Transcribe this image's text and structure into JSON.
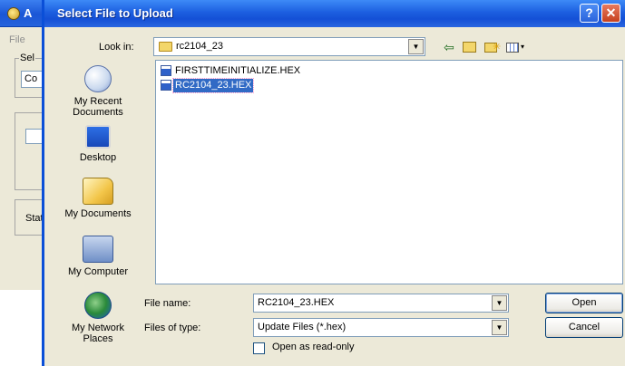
{
  "background_window": {
    "title_fragment": "A",
    "menu_file": "File",
    "group1_label": "Sel",
    "combo_value": "Co",
    "group3_label": "Stat"
  },
  "dialog": {
    "title": "Select File to Upload",
    "help_glyph": "?",
    "close_glyph": "✕",
    "look_in_label": "Look in:",
    "look_in_value": "rc2104_23",
    "toolbar": {
      "back_glyph": "⇦",
      "views_arrow": "▾"
    },
    "places": [
      {
        "label": "My Recent\nDocuments",
        "icon": "recent-documents-icon"
      },
      {
        "label": "Desktop",
        "icon": "desktop-icon"
      },
      {
        "label": "My Documents",
        "icon": "my-documents-icon"
      },
      {
        "label": "My Computer",
        "icon": "my-computer-icon"
      },
      {
        "label": "My Network\nPlaces",
        "icon": "network-places-icon"
      }
    ],
    "files": [
      {
        "name": "FIRSTTIMEINITIALIZE.HEX",
        "selected": false
      },
      {
        "name": "RC2104_23.HEX",
        "selected": true
      }
    ],
    "file_name_label": "File name:",
    "file_name_value": "RC2104_23.HEX",
    "files_of_type_label": "Files of type:",
    "files_of_type_value": "Update Files (*.hex)",
    "readonly_label": "Open as read-only",
    "open_button": "Open",
    "cancel_button": "Cancel",
    "dropdown_arrow": "▼"
  },
  "colors": {
    "titlebar": "#1c5fe0",
    "selection": "#316ac5",
    "dialog_bg": "#ece9d8"
  }
}
